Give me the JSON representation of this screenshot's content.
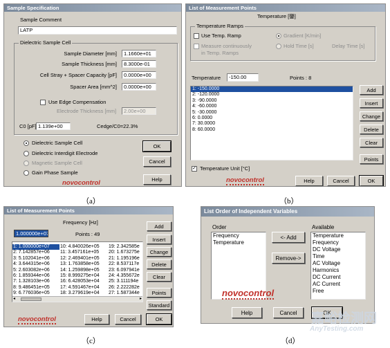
{
  "a": {
    "caption": "（a）",
    "title": "Sample Specification",
    "comment_label": "Sample Comment",
    "comment_value": "LATP",
    "group": "Dielectric Sample Cell",
    "fields": [
      {
        "label": "Sample Diameter [mm]",
        "value": "1.1660e+01"
      },
      {
        "label": "Sample Thickness [mm]",
        "value": "8.3000e-01"
      },
      {
        "label": "Cell Stray + Spacer Capacity [pF]",
        "value": "0.0000e+00"
      },
      {
        "label": "Spacer Area [mm^2]",
        "value": "0.0000e+00"
      }
    ],
    "edge_label": "Use Edge Compensation",
    "electrode_label": "Electrode Thickness [mm]",
    "electrode_value": "2.00e+00",
    "c0_label": "C0 [pF]",
    "c0_value": "1.139e+00",
    "cedge": "Cedge/C0=22.3%",
    "radios": [
      "Dielectric Sample Cell",
      "Dielectric Interdigit Electrode",
      "Magnetic Sample Cell",
      "Gain Phase Sample"
    ],
    "ok": "OK",
    "cancel": "Cancel",
    "help": "Help",
    "logo": "novocontrol"
  },
  "b": {
    "caption": "（b）",
    "title": "List of Measurement Points",
    "heading": "Temperature [鑾]",
    "ramps": "Temperature Ramps",
    "use_ramp": "Use Temp. Ramp",
    "gradient": "Gradient [K/min]",
    "measure_cont": "Measure continuously",
    "in_ramps": "in Temp. Ramps",
    "hold": "Hold Time [s]",
    "delay": "Delay Time [s]",
    "temp_label": "Temperature",
    "temp_value": "-150.00",
    "points": "Points :  8",
    "items": [
      "1: -150.0000",
      "2: -120.0000",
      "3: -90.0000",
      "4: -60.0000",
      "5: -30.0000",
      "6: 0.0000",
      "7: 30.0000",
      "8: 60.0000"
    ],
    "buttons": [
      "Add",
      "Insert",
      "Change",
      "Delete",
      "Clear",
      "Points"
    ],
    "unit_label": "Temperature Unit [°C]",
    "help": "Help",
    "cancel": "Cancel",
    "ok": "OK",
    "logo": "novocontrol"
  },
  "c": {
    "caption": "（c）",
    "title": "List of Measurement Points",
    "heading": "Frequency [Hz]",
    "freq_value": "1.000000e+07",
    "points": "Points :       49",
    "col1": [
      "1: 1.000000e+07",
      "2: 7.142857e+06",
      "3: 5.102041e+06",
      "4: 3.644315e+06",
      "5: 2.603082e+06",
      "6: 1.859344e+06",
      "7: 1.328103e+06",
      "8: 9.486451e+05",
      "9: 6.776036e+05"
    ],
    "col2": [
      "10: 4.840026e+05",
      "11: 3.457161e+05",
      "12: 2.469401e+05",
      "13: 1.763858e+05",
      "14: 1.259898e+05",
      "15: 8.999275e+04",
      "16: 6.428053e+04",
      "17: 4.591467e+04",
      "18: 3.279619e+04"
    ],
    "col3": [
      "19: 2.342585e",
      "20: 1.673275e",
      "21: 1.195196e",
      "22: 8.537117e",
      "23: 6.097941e",
      "24: 4.355672e",
      "25: 3.111194e",
      "26: 2.222282e",
      "27: 1.587344e"
    ],
    "buttons": [
      "Add",
      "Insert",
      "Change",
      "Delete",
      "Clear",
      "Points",
      "Standard"
    ],
    "help": "Help",
    "cancel": "Cancel",
    "ok": "OK",
    "logo": "novocontrol"
  },
  "d": {
    "caption": "（d）",
    "title": "List Order of Independent Variables",
    "order_label": "Order",
    "available_label": "Available",
    "order": [
      "Frequency",
      "Temperature"
    ],
    "available": [
      "Temperature",
      "Frequency",
      "DC Voltage",
      "Time",
      "AC Voltage",
      "Harmonics",
      "DC Current",
      "AC Current",
      "Free"
    ],
    "add": "<- Add",
    "remove": "Remove->",
    "help": "Help",
    "cancel": "Cancel",
    "ok": "OK",
    "logo": "novocontrol"
  },
  "watermark": {
    "cn": "嘉峪检测网",
    "en": "AnyTesting.com"
  }
}
